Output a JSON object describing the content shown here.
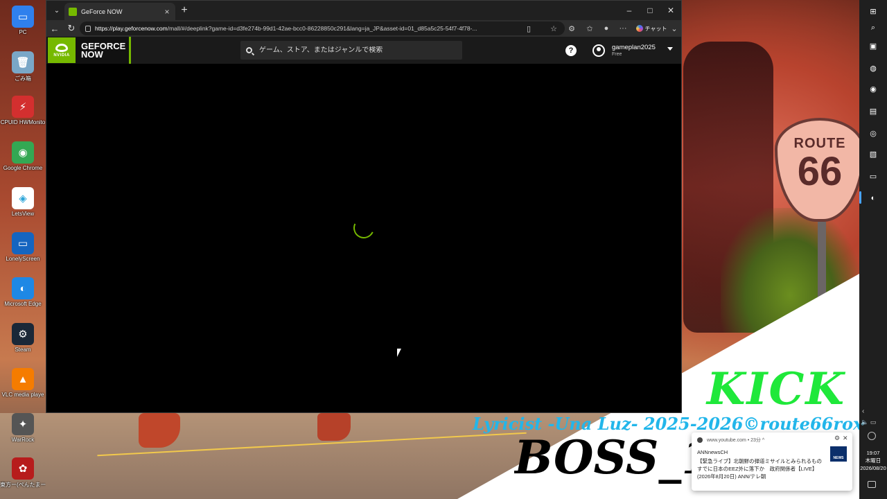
{
  "desktop": {
    "icons": [
      {
        "label": "PC",
        "icon": "pc-icon",
        "color": "#2f80ed",
        "glyph": "▭"
      },
      {
        "label": "ごみ箱",
        "icon": "recycle-bin-icon",
        "color": "#7aa7c7",
        "glyph": "🗑"
      },
      {
        "label": "CPUID HWMonito",
        "icon": "hwmonitor-icon",
        "color": "#d32f2f",
        "glyph": "⚡"
      },
      {
        "label": "Google Chrome",
        "icon": "chrome-icon",
        "color": "#34a853",
        "glyph": "◉"
      },
      {
        "label": "LetsView",
        "icon": "letsview-icon",
        "color": "#ffffff",
        "glyph": "◈"
      },
      {
        "label": "LonelyScreen",
        "icon": "lonelyscreen-icon",
        "color": "#1565c0",
        "glyph": "▭"
      },
      {
        "label": "Microsoft Edge",
        "icon": "edge-icon",
        "color": "#1e88e5",
        "glyph": "◐"
      },
      {
        "label": "Steam",
        "icon": "steam-icon",
        "color": "#1b2838",
        "glyph": "⚙"
      },
      {
        "label": "VLC media playe",
        "icon": "vlc-icon",
        "color": "#f57c00",
        "glyph": "▲"
      },
      {
        "label": "WarRock",
        "icon": "warrock-icon",
        "color": "#555555",
        "glyph": "✦"
      },
      {
        "label": "東方ー(ぺんたまー",
        "icon": "touhou-icon",
        "color": "#b71c1c",
        "glyph": "✿"
      }
    ],
    "overlay": {
      "kick": "KICK",
      "lyricist": "Lyricist -Una Luz- 2025-2026©route66rox",
      "boss": "BOSS_1",
      "sign_top": "ROUTE",
      "sign_num": "66"
    }
  },
  "browser": {
    "tab_title": "GeForce NOW",
    "url_domain": "https://play.geforcenow.com",
    "url_rest": "/mall/#/deeplink?game-id=d3fe274b-99d1-42ae-bcc0-86228850c291&lang=ja_JP&asset-id=01_d85a5c25-54f7-4f78-...",
    "chat_label": "チャット"
  },
  "gfn": {
    "logo_brand": "NVIDIA",
    "logo_line1": "GEFORCE",
    "logo_line2": "NOW",
    "search_placeholder": "ゲーム、ストア、またはジャンルで検索",
    "help_glyph": "?",
    "user_name": "gameplan2025",
    "user_tier": "Free",
    "accent": "#76b900"
  },
  "taskbar": {
    "clock_time": "19:07",
    "clock_day": "木曜日",
    "clock_date": "2026/08/20"
  },
  "notification": {
    "source": "www.youtube.com • 23分 ^",
    "channel": "ANNnewsCH",
    "body": "【緊急ライブ】北朝鮮の弾道ミサイルとみられるもの　すでに日本のEEZ外に落下か　政府関係者【LIVE】(2026年8月20日) ANN/テレ朝",
    "thumb_label": "NEWS"
  }
}
